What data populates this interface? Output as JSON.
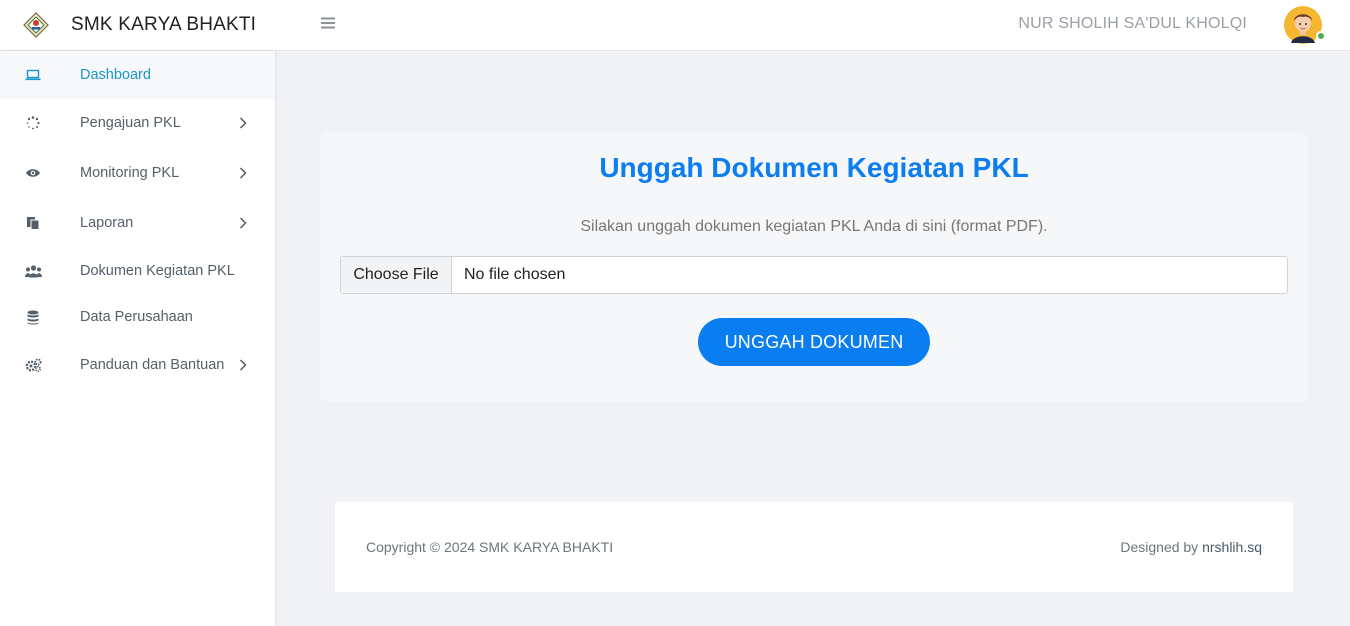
{
  "header": {
    "brand_name": "SMK KARYA BHAKTI",
    "user_name": "NUR SHOLIH SA'DUL KHOLQI",
    "status": "online"
  },
  "sidebar": {
    "items": [
      {
        "label": "Dashboard",
        "icon": "laptop-icon",
        "active": true,
        "has_submenu": false
      },
      {
        "label": "Pengajuan PKL",
        "icon": "spinner-icon",
        "active": false,
        "has_submenu": true
      },
      {
        "label": "Monitoring PKL",
        "icon": "eye-icon",
        "active": false,
        "has_submenu": true
      },
      {
        "label": "Laporan",
        "icon": "copy-icon",
        "active": false,
        "has_submenu": true
      },
      {
        "label": "Dokumen Kegiatan PKL",
        "icon": "users-icon",
        "active": false,
        "has_submenu": false
      },
      {
        "label": "Data Perusahaan",
        "icon": "database-icon",
        "active": false,
        "has_submenu": false
      },
      {
        "label": "Panduan dan Bantuan",
        "icon": "cogs-icon",
        "active": false,
        "has_submenu": true
      }
    ]
  },
  "main": {
    "title": "Unggah Dokumen Kegiatan PKL",
    "subtitle": "Silakan unggah dokumen kegiatan PKL Anda di sini (format PDF).",
    "file_button_label": "Choose File",
    "file_status": "No file chosen",
    "upload_button_label": "UNGGAH DOKUMEN"
  },
  "footer": {
    "copyright": "Copyright © 2024 SMK KARYA BHAKTI",
    "designed_by_prefix": "Designed by ",
    "designer": "nrshlih.sq"
  },
  "colors": {
    "accent": "#0a7df1",
    "active_link": "#1798c8",
    "background": "#f1f2f6",
    "status_online": "#4caf50"
  }
}
